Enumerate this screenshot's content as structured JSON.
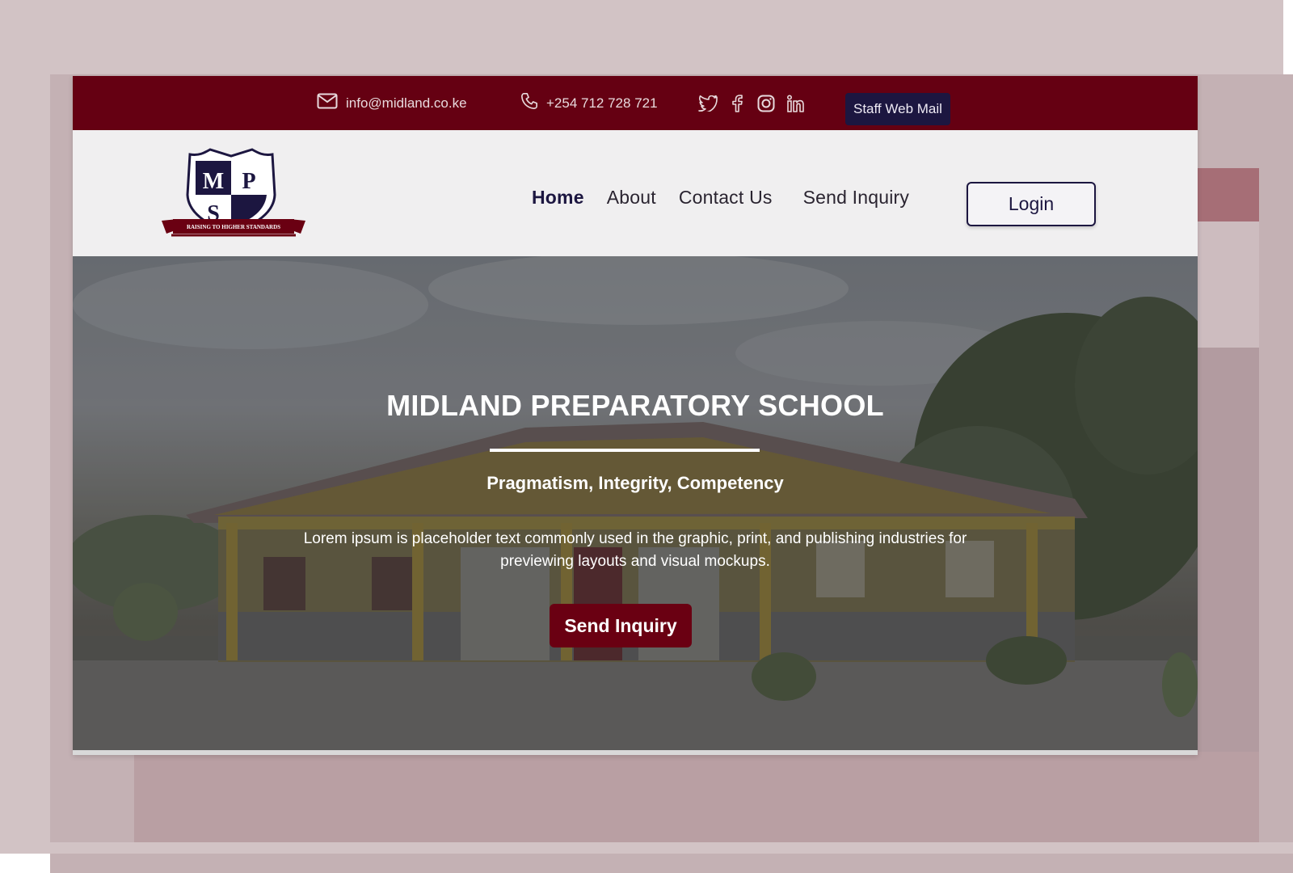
{
  "topbar": {
    "email": "info@midland.co.ke",
    "phone": "+254 712 728 721",
    "social": [
      "twitter-icon",
      "facebook-icon",
      "instagram-icon",
      "linkedin-icon"
    ],
    "staff_mail_label": "Staff Web Mail"
  },
  "logo": {
    "letters": [
      "M",
      "P",
      "S"
    ],
    "banner": "RAISING TO HIGHER STANDARDS"
  },
  "nav": {
    "items": [
      {
        "label": "Home",
        "active": true
      },
      {
        "label": "About"
      },
      {
        "label": "Contact Us"
      },
      {
        "label": "Send Inquiry"
      }
    ],
    "login_label": "Login"
  },
  "hero": {
    "title": "MIDLAND PREPARATORY SCHOOL",
    "motto": "Pragmatism, Integrity, Competency",
    "description": "Lorem ipsum is placeholder text commonly used in the graphic, print, and publishing industries for previewing layouts and visual mockups.",
    "button_label": "Send Inquiry"
  },
  "colors": {
    "brand_maroon": "#650012",
    "navy": "#1c1640"
  }
}
